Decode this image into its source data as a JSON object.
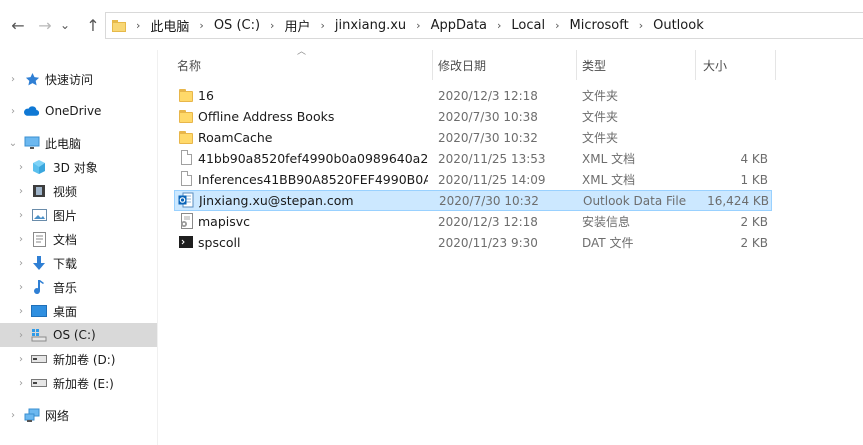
{
  "breadcrumb": [
    "此电脑",
    "OS (C:)",
    "用户",
    "jinxiang.xu",
    "AppData",
    "Local",
    "Microsoft",
    "Outlook"
  ],
  "nav_buttons": {
    "back": "←",
    "forward": "→",
    "recent": "⌄",
    "up": "↑"
  },
  "sidebar": {
    "items": [
      {
        "label": "快速访问",
        "icon": "star-icon"
      },
      {
        "label": "OneDrive",
        "icon": "cloud-icon"
      },
      {
        "label": "此电脑",
        "icon": "computer-icon"
      },
      {
        "label": "3D 对象",
        "icon": "cube-3d-icon"
      },
      {
        "label": "视频",
        "icon": "video-icon"
      },
      {
        "label": "图片",
        "icon": "picture-icon"
      },
      {
        "label": "文档",
        "icon": "document-icon"
      },
      {
        "label": "下载",
        "icon": "download-icon"
      },
      {
        "label": "音乐",
        "icon": "music-icon"
      },
      {
        "label": "桌面",
        "icon": "desktop-icon"
      },
      {
        "label": "OS (C:)",
        "icon": "os-drive-icon"
      },
      {
        "label": "新加卷 (D:)",
        "icon": "drive-icon"
      },
      {
        "label": "新加卷 (E:)",
        "icon": "drive-icon"
      },
      {
        "label": "网络",
        "icon": "network-icon"
      }
    ],
    "selected": "OS (C:)"
  },
  "columns": {
    "name": "名称",
    "date": "修改日期",
    "type": "类型",
    "size": "大小"
  },
  "files": [
    {
      "name": "16",
      "date": "2020/12/3 12:18",
      "type": "文件夹",
      "size": "",
      "icon": "folder-icon"
    },
    {
      "name": "Offline Address Books",
      "date": "2020/7/30 10:38",
      "type": "文件夹",
      "size": "",
      "icon": "folder-icon"
    },
    {
      "name": "RoamCache",
      "date": "2020/7/30 10:32",
      "type": "文件夹",
      "size": "",
      "icon": "folder-icon"
    },
    {
      "name": "41bb90a8520fef4990b0a0989640a2f...",
      "date": "2020/11/25 13:53",
      "type": "XML 文档",
      "size": "4 KB",
      "icon": "xml-file-icon"
    },
    {
      "name": "Inferences41BB90A8520FEF4990B0A0...",
      "date": "2020/11/25 14:09",
      "type": "XML 文档",
      "size": "1 KB",
      "icon": "xml-file-icon"
    },
    {
      "name": "Jinxiang.xu@stepan.com",
      "date": "2020/7/30 10:32",
      "type": "Outlook Data File",
      "size": "16,424 KB",
      "icon": "outlook-data-file-icon"
    },
    {
      "name": "mapisvc",
      "date": "2020/12/3 12:18",
      "type": "安装信息",
      "size": "2 KB",
      "icon": "setup-info-file-icon"
    },
    {
      "name": "spscoll",
      "date": "2020/11/23 9:30",
      "type": "DAT 文件",
      "size": "2 KB",
      "icon": "dat-file-icon"
    }
  ],
  "selected_file": "Jinxiang.xu@stepan.com",
  "colors": {
    "selection_bg": "#cce8ff",
    "selection_border": "#99d1ff",
    "nav_selected_bg": "#d9d9d9",
    "folder_yellow": "#ffd96a"
  }
}
